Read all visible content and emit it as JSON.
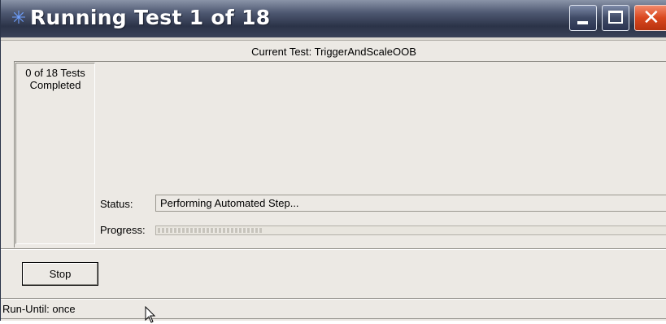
{
  "window": {
    "title": "Running Test 1 of 18",
    "icon": "agilent-spark-icon",
    "controls": {
      "minimize": "minimize-icon",
      "maximize": "maximize-icon",
      "close": "close-icon"
    }
  },
  "current_test": {
    "text": "Current Test: TriggerAndScaleOOB"
  },
  "completed": {
    "text": "0 of 18 Tests Completed"
  },
  "status": {
    "label": "Status:",
    "value": "Performing Automated Step..."
  },
  "progress": {
    "label": "Progress:",
    "fraction": 0.2
  },
  "stop_button": {
    "label": "Stop"
  },
  "run_until": {
    "text": "Run-Until: once"
  },
  "colors": {
    "close_button": "#d9471f",
    "titlebar": "#2b3348",
    "window_bg": "#ece9e4"
  }
}
